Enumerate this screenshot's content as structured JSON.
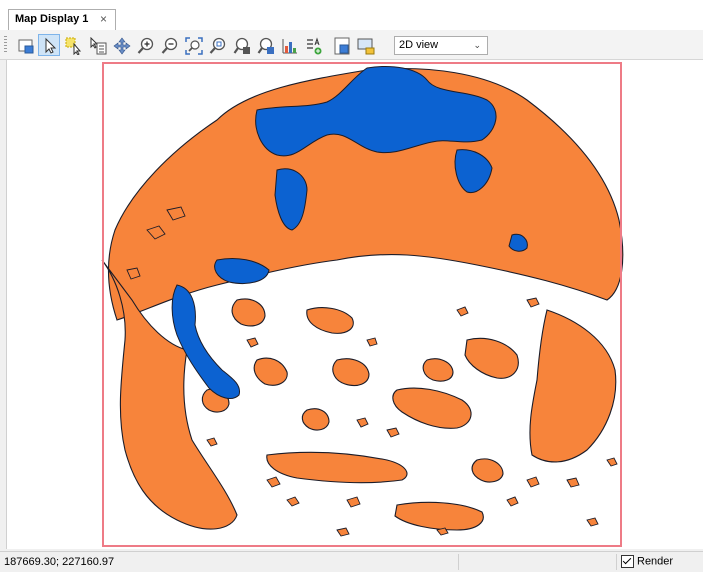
{
  "tabs": [
    {
      "label": "Map Display 1",
      "close": "×"
    }
  ],
  "toolbar": {
    "tools": [
      "add-map-icon",
      "select-arrow-icon",
      "select-rectangle-icon",
      "select-info-icon",
      "pan-icon",
      "zoom-in-icon",
      "zoom-out-icon",
      "zoom-extent-icon",
      "zoom-layer-icon",
      "zoom-selection-icon",
      "zoom-region-icon",
      "display-chart-icon",
      "legend-icon",
      "overview-icon",
      "screenshot-icon"
    ],
    "active_tool": "select-arrow-icon",
    "view_mode": {
      "selected": "2D view",
      "chevron": "⌄"
    }
  },
  "map": {
    "fill_colors": {
      "land": "#f7843b",
      "water": "#0c62d1",
      "outline": "#1c1c28",
      "extent_border": "#ee7b86"
    }
  },
  "status": {
    "coordinates": "187669.30; 227160.97",
    "render_label": "Render",
    "render_checked": true
  }
}
